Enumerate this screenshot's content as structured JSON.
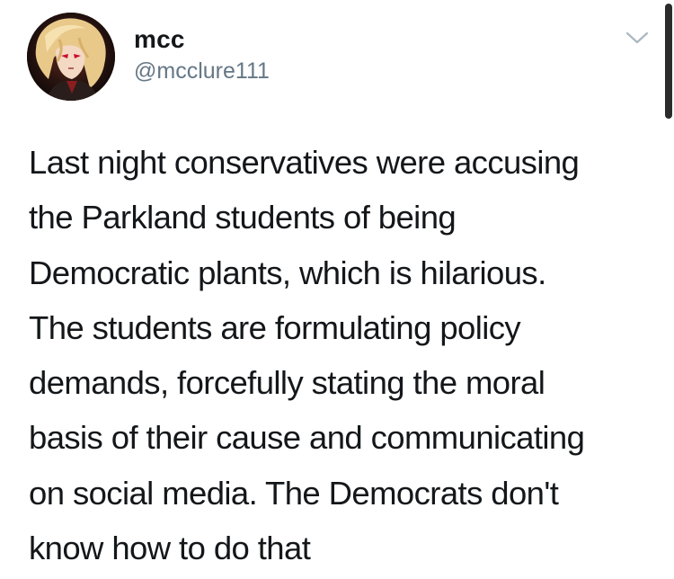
{
  "user": {
    "display_name": "mcc",
    "handle": "@mcclure111",
    "avatar_icon": "anime-avatar-icon"
  },
  "controls": {
    "menu_icon": "chevron-down-icon"
  },
  "tweet": {
    "lines": [
      "Last night conservatives were accusing",
      "the Parkland students of being",
      "Democratic plants, which is hilarious.",
      "The students are formulating policy",
      "demands, forcefully stating the moral",
      "basis of their cause and communicating",
      "on social media. The Democrats don't",
      "know how to do that"
    ]
  },
  "colors": {
    "text": "#14171a",
    "secondary_text": "#657786",
    "chevron": "#aab8c2",
    "background": "#ffffff"
  }
}
